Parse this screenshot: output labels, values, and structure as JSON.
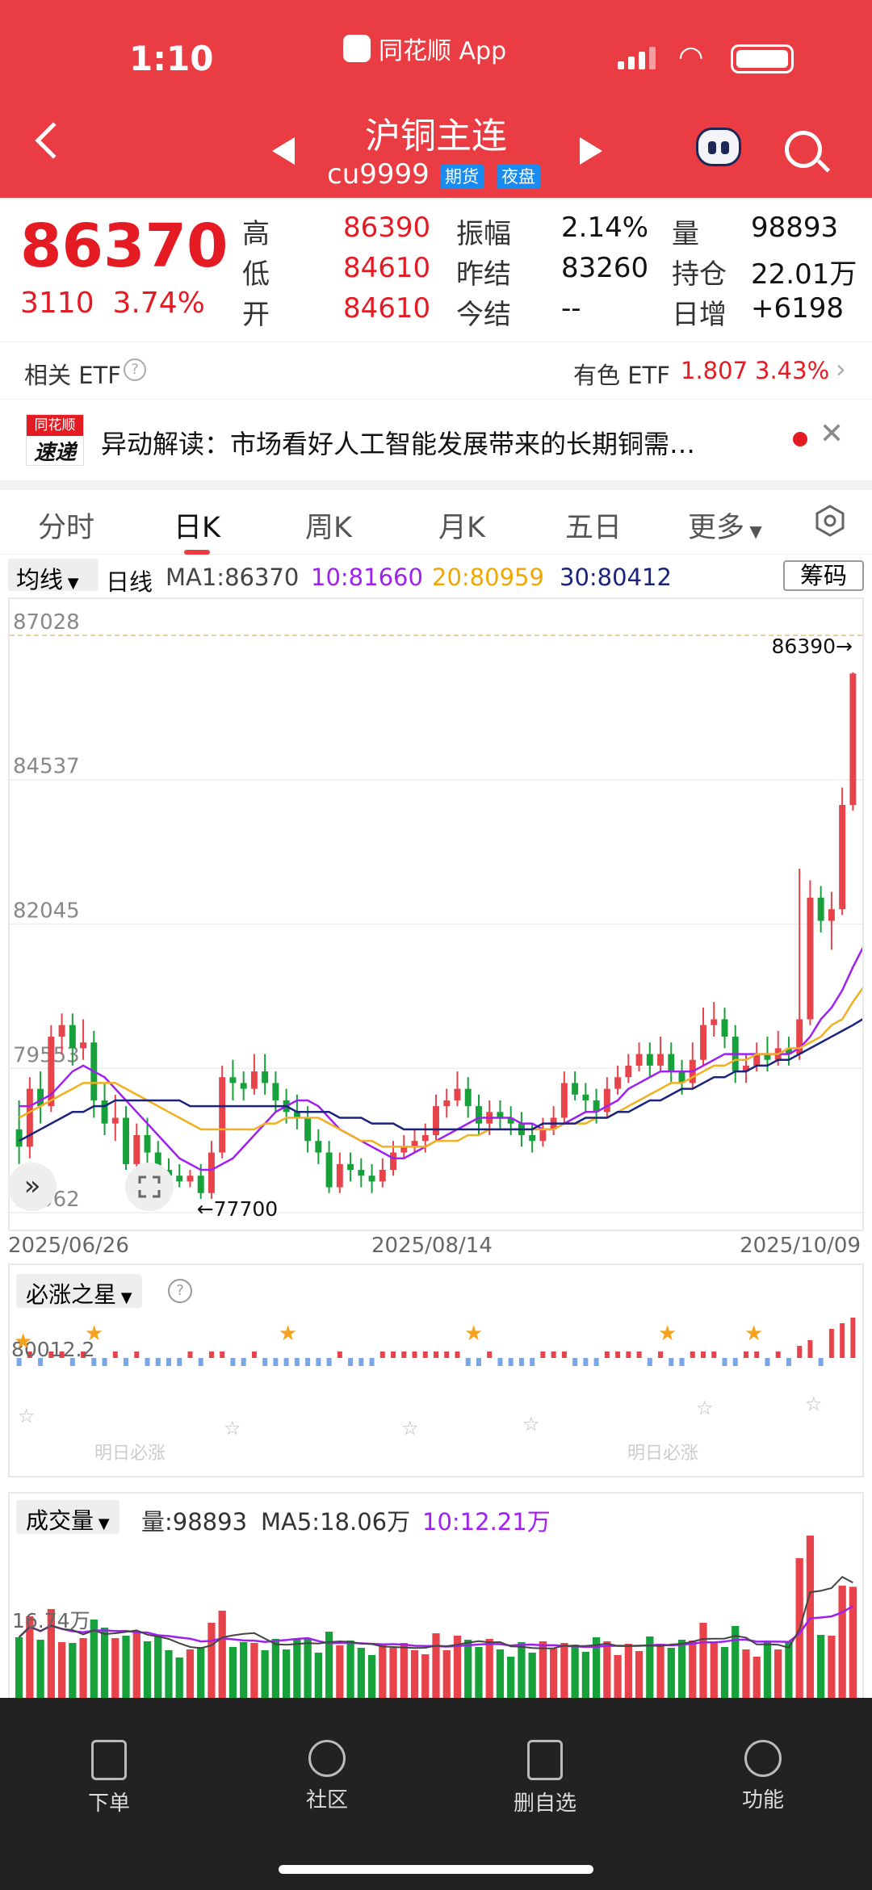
{
  "status": {
    "time": "1:10",
    "app": "同花顺 App"
  },
  "header": {
    "title": "沪铜主连",
    "code": "cu9999",
    "badge_futures": "期货",
    "badge_night": "夜盘"
  },
  "quote": {
    "price": "86370",
    "change": "3110",
    "change_pct": "3.74%",
    "rows": [
      {
        "l1": "高",
        "v1": "86390",
        "l2": "振幅",
        "v2": "2.14%",
        "l3": "量",
        "v3": "98893"
      },
      {
        "l1": "低",
        "v1": "84610",
        "l2": "昨结",
        "v2": "83260",
        "l3": "持仓",
        "v3": "22.01万"
      },
      {
        "l1": "开",
        "v1": "84610",
        "l2": "今结",
        "v2": "--",
        "l3": "日增",
        "v3": "+6198"
      }
    ]
  },
  "etf": {
    "label": "相关 ETF",
    "name": "有色 ETF",
    "price": "1.807",
    "pct": "3.43%"
  },
  "news": {
    "brand1": "同花顺",
    "brand2": "速递",
    "text": "异动解读：市场看好人工智能发展带来的长期铜需…"
  },
  "tabs": [
    "分时",
    "日K",
    "周K",
    "月K",
    "五日",
    "更多"
  ],
  "legend": {
    "ma_type": "均线",
    "period": "日线",
    "ma1": "MA1:86370",
    "ma10": "10:81660",
    "ma20": "20:80959",
    "ma30": "30:80412",
    "chip": "筹码"
  },
  "colors": {
    "up": "#e8434b",
    "down": "#17a13a",
    "ma10": "#a020f0",
    "ma20": "#f0b020",
    "ma30": "#1a237e"
  },
  "chart_data": {
    "type": "candlestick",
    "y_ticks": [
      "87028",
      "84537",
      "82045",
      "79553",
      "77062"
    ],
    "ylim": [
      77062,
      87028
    ],
    "x_ticks": [
      "2025/06/26",
      "2025/08/14",
      "2025/10/09"
    ],
    "high_label": "86390→",
    "low_label": "←77700",
    "candles": [
      [
        78500,
        78200,
        79000,
        77900
      ],
      [
        78200,
        79200,
        79400,
        78000
      ],
      [
        79200,
        78900,
        79500,
        78600
      ],
      [
        78900,
        80100,
        80300,
        78800
      ],
      [
        80100,
        80300,
        80500,
        79800
      ],
      [
        80300,
        79900,
        80500,
        79600
      ],
      [
        79900,
        80000,
        80400,
        79700
      ],
      [
        80000,
        79000,
        80200,
        78700
      ],
      [
        79000,
        78600,
        79300,
        78400
      ],
      [
        78600,
        78700,
        79100,
        78300
      ],
      [
        78700,
        77900,
        78900,
        77800
      ],
      [
        77900,
        78400,
        78600,
        77700
      ],
      [
        78400,
        78100,
        78700,
        77900
      ],
      [
        78100,
        77800,
        78300,
        77700
      ],
      [
        77800,
        77700,
        78000,
        77600
      ],
      [
        77700,
        77600,
        77900,
        77500
      ],
      [
        77600,
        77700,
        77800,
        77500
      ],
      [
        77700,
        77400,
        77900,
        77300
      ],
      [
        77400,
        78100,
        78300,
        77300
      ],
      [
        78100,
        79400,
        79600,
        78000
      ],
      [
        79400,
        79300,
        79700,
        79000
      ],
      [
        79300,
        79200,
        79500,
        79000
      ],
      [
        79200,
        79500,
        79800,
        79100
      ],
      [
        79500,
        79300,
        79800,
        79100
      ],
      [
        79300,
        79000,
        79500,
        78800
      ],
      [
        79000,
        78800,
        79200,
        78600
      ],
      [
        78800,
        78700,
        79100,
        78500
      ],
      [
        78700,
        78300,
        78900,
        78100
      ],
      [
        78300,
        78100,
        78500,
        77900
      ],
      [
        78100,
        77500,
        78300,
        77400
      ],
      [
        77500,
        77900,
        78100,
        77400
      ],
      [
        77900,
        77800,
        78100,
        77600
      ],
      [
        77800,
        77700,
        78000,
        77500
      ],
      [
        77700,
        77600,
        77900,
        77400
      ],
      [
        77600,
        77800,
        78000,
        77500
      ],
      [
        77800,
        78100,
        78300,
        77700
      ],
      [
        78100,
        78200,
        78400,
        78000
      ],
      [
        78200,
        78300,
        78500,
        78100
      ],
      [
        78300,
        78400,
        78600,
        78100
      ],
      [
        78400,
        78900,
        79100,
        78300
      ],
      [
        78900,
        79000,
        79200,
        78700
      ],
      [
        79000,
        79200,
        79500,
        78900
      ],
      [
        79200,
        78900,
        79400,
        78700
      ],
      [
        78900,
        78600,
        79100,
        78400
      ],
      [
        78600,
        78800,
        79000,
        78400
      ],
      [
        78800,
        78700,
        79000,
        78500
      ],
      [
        78700,
        78600,
        78900,
        78400
      ],
      [
        78600,
        78400,
        78800,
        78200
      ],
      [
        78400,
        78300,
        78600,
        78100
      ],
      [
        78300,
        78500,
        78700,
        78200
      ],
      [
        78500,
        78700,
        78900,
        78400
      ],
      [
        78700,
        79300,
        79500,
        78600
      ],
      [
        79300,
        79100,
        79500,
        79000
      ],
      [
        79100,
        79000,
        79300,
        78800
      ],
      [
        79000,
        78800,
        79200,
        78600
      ],
      [
        78800,
        79200,
        79400,
        78700
      ],
      [
        79200,
        79400,
        79600,
        79100
      ],
      [
        79400,
        79600,
        79800,
        79300
      ],
      [
        79600,
        79800,
        80000,
        79500
      ],
      [
        79800,
        79600,
        80000,
        79400
      ],
      [
        79600,
        79800,
        80100,
        79500
      ],
      [
        79800,
        79500,
        80000,
        79300
      ],
      [
        79500,
        79300,
        79700,
        79100
      ],
      [
        79300,
        79700,
        80000,
        79200
      ],
      [
        79700,
        80300,
        80600,
        79600
      ],
      [
        80300,
        80400,
        80700,
        80100
      ],
      [
        80400,
        80100,
        80600,
        79900
      ],
      [
        80100,
        79500,
        80300,
        79300
      ],
      [
        79500,
        79600,
        79800,
        79300
      ],
      [
        79600,
        79800,
        80000,
        79500
      ],
      [
        79800,
        79700,
        80100,
        79500
      ],
      [
        79700,
        79900,
        80200,
        79600
      ],
      [
        79900,
        79800,
        80100,
        79600
      ],
      [
        79800,
        80400,
        83000,
        79700
      ],
      [
        80400,
        82500,
        82800,
        80300
      ],
      [
        82500,
        82100,
        82700,
        81900
      ],
      [
        82100,
        82300,
        82600,
        81600
      ],
      [
        82300,
        84100,
        84400,
        82200
      ],
      [
        84100,
        86370,
        86390,
        84000
      ]
    ],
    "ma10": [
      78900,
      78900,
      79000,
      79100,
      79300,
      79500,
      79600,
      79500,
      79400,
      79200,
      79000,
      78800,
      78600,
      78400,
      78200,
      78000,
      77900,
      77800,
      77800,
      77900,
      78000,
      78200,
      78400,
      78600,
      78800,
      78900,
      79000,
      79000,
      78900,
      78700,
      78500,
      78400,
      78300,
      78200,
      78100,
      78000,
      78000,
      78100,
      78200,
      78300,
      78400,
      78500,
      78600,
      78700,
      78700,
      78700,
      78700,
      78600,
      78600,
      78500,
      78500,
      78600,
      78700,
      78800,
      78800,
      78900,
      79000,
      79200,
      79300,
      79400,
      79500,
      79500,
      79500,
      79500,
      79600,
      79700,
      79800,
      79800,
      79800,
      79800,
      79800,
      79800,
      79800,
      79900,
      80100,
      80400,
      80600,
      80900,
      81300,
      81660
    ],
    "ma20": [
      78700,
      78800,
      78900,
      79000,
      79100,
      79200,
      79300,
      79300,
      79300,
      79300,
      79200,
      79100,
      79000,
      78900,
      78800,
      78700,
      78600,
      78500,
      78500,
      78500,
      78500,
      78500,
      78500,
      78600,
      78600,
      78700,
      78700,
      78700,
      78700,
      78600,
      78500,
      78400,
      78300,
      78300,
      78200,
      78200,
      78200,
      78200,
      78200,
      78300,
      78300,
      78300,
      78400,
      78400,
      78500,
      78500,
      78500,
      78500,
      78500,
      78500,
      78500,
      78600,
      78600,
      78600,
      78700,
      78700,
      78800,
      78900,
      79000,
      79100,
      79200,
      79300,
      79300,
      79400,
      79500,
      79600,
      79600,
      79700,
      79700,
      79800,
      79800,
      79800,
      79900,
      79900,
      80000,
      80100,
      80300,
      80400,
      80700,
      80959
    ],
    "ma30": [
      78300,
      78400,
      78500,
      78600,
      78700,
      78800,
      78800,
      78900,
      78900,
      79000,
      79000,
      79000,
      79000,
      79000,
      79000,
      79000,
      78900,
      78900,
      78900,
      78900,
      78900,
      78900,
      78900,
      78900,
      78900,
      78900,
      78800,
      78800,
      78800,
      78800,
      78700,
      78700,
      78700,
      78600,
      78600,
      78600,
      78500,
      78500,
      78500,
      78500,
      78500,
      78500,
      78500,
      78500,
      78500,
      78500,
      78500,
      78500,
      78500,
      78600,
      78600,
      78600,
      78600,
      78700,
      78700,
      78700,
      78800,
      78800,
      78900,
      79000,
      79000,
      79100,
      79200,
      79200,
      79300,
      79400,
      79400,
      79500,
      79500,
      79600,
      79600,
      79700,
      79700,
      79800,
      79900,
      80000,
      80100,
      80200,
      80300,
      80412
    ]
  },
  "indicator": {
    "name": "必涨之星",
    "level": "80012.2",
    "mark": "明日必涨"
  },
  "volume": {
    "name": "成交量",
    "vol": "量:98893",
    "ma5": "MA5:18.06万",
    "ma10": "10:12.21万",
    "tick": "16.74万"
  },
  "bottom_nav": [
    "下单",
    "社区",
    "删自选",
    "功能"
  ]
}
